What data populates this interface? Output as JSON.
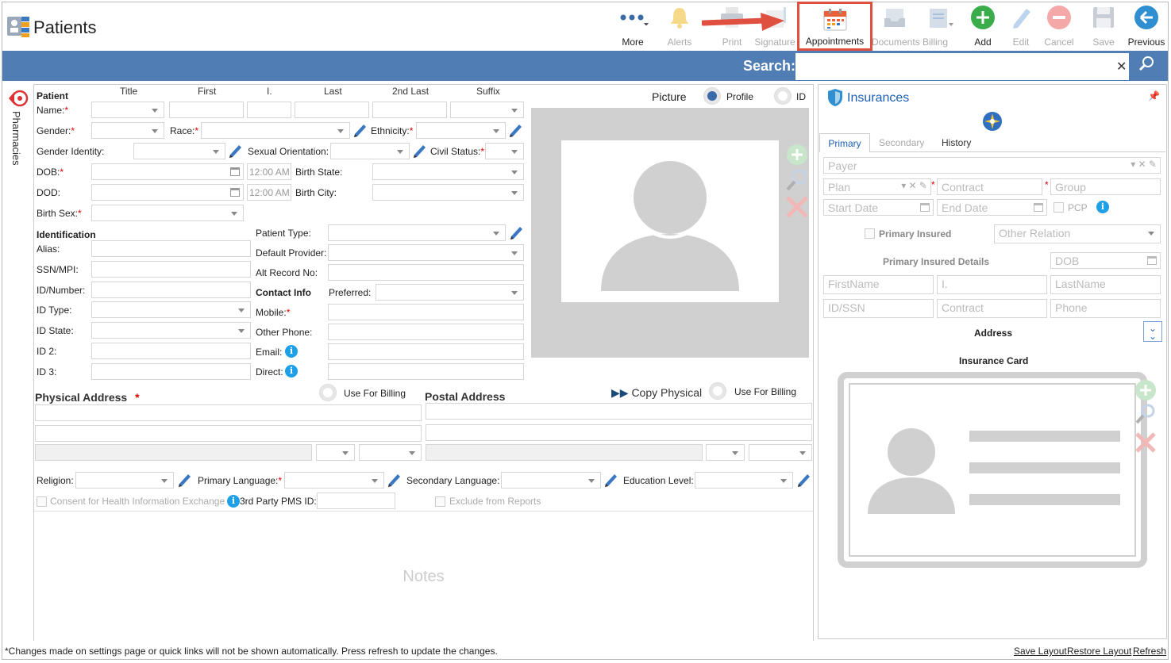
{
  "app": {
    "title": "Patients"
  },
  "toolbar": {
    "more": "More",
    "alerts": "Alerts",
    "print": "Print",
    "signature": "Signature",
    "appointments": "Appointments",
    "documents": "Documents",
    "billing": "Billing",
    "add": "Add",
    "edit": "Edit",
    "cancel": "Cancel",
    "save": "Save",
    "previous": "Previous"
  },
  "search": {
    "label": "Search:",
    "value": ""
  },
  "sidebar": {
    "pharmacies": "Pharmacies"
  },
  "patient": {
    "section": "Patient",
    "col_title": "Title",
    "col_first": "First",
    "col_i": "I.",
    "col_last": "Last",
    "col_2nd_last": "2nd Last",
    "col_suffix": "Suffix",
    "name": "Name:",
    "gender": "Gender:",
    "race": "Race:",
    "ethnicity": "Ethnicity:",
    "gender_identity": "Gender Identity:",
    "sexual_orientation": "Sexual Orientation:",
    "civil_status": "Civil Status:",
    "dob": "DOB:",
    "dod": "DOD:",
    "time1": "12:00 AM",
    "time2": "12:00 AM",
    "birth_state": "Birth State:",
    "birth_city": "Birth City:",
    "birth_sex": "Birth Sex:"
  },
  "picture": {
    "label": "Picture",
    "profile": "Profile",
    "id": "ID"
  },
  "identification": {
    "section": "Identification",
    "alias": "Alias:",
    "ssn": "SSN/MPI:",
    "id_number": "ID/Number:",
    "id_type": "ID Type:",
    "id_state": "ID State:",
    "id2": "ID 2:",
    "id3": "ID 3:",
    "patient_type": "Patient Type:",
    "default_provider": "Default Provider:",
    "alt_record": "Alt Record No:"
  },
  "contact": {
    "section": "Contact Info",
    "preferred": "Preferred:",
    "mobile": "Mobile:",
    "other_phone": "Other Phone:",
    "email": "Email:",
    "direct": "Direct:"
  },
  "address": {
    "physical": "Physical Address",
    "use_for_billing": "Use For Billing",
    "postal": "Postal Address",
    "copy_physical": "Copy Physical",
    "use_for_billing2": "Use For Billing"
  },
  "misc": {
    "religion": "Religion:",
    "primary_language": "Primary Language:",
    "secondary_language": "Secondary Language:",
    "education_level": "Education Level:",
    "consent": "Consent for Health Information Exchange",
    "third_party": "3rd Party PMS ID:",
    "exclude": "Exclude from Reports",
    "notes": "Notes"
  },
  "insurances": {
    "title": "Insurances",
    "tab_primary": "Primary",
    "tab_secondary": "Secondary",
    "tab_history": "History",
    "payer": "Payer",
    "plan": "Plan",
    "contract": "Contract",
    "group": "Group",
    "start_date": "Start Date",
    "end_date": "End Date",
    "pcp": "PCP",
    "primary_insured": "Primary Insured",
    "other_relation": "Other Relation",
    "primary_insured_details": "Primary Insured Details",
    "dob": "DOB",
    "firstname": "FirstName",
    "initial": "I.",
    "lastname": "LastName",
    "id_ssn": "ID/SSN",
    "contract2": "Contract",
    "phone": "Phone",
    "address": "Address",
    "insurance_card": "Insurance Card"
  },
  "footer": {
    "note": "*Changes made on settings page or quick links will not be shown automatically. Press refresh to update the changes.",
    "save_layout": "Save Layout",
    "restore_layout": "Restore Layout",
    "refresh": "Refresh"
  },
  "colors": {
    "search_bar": "#4f7db4",
    "accent": "#1a5fb4",
    "highlight": "#e05040"
  }
}
